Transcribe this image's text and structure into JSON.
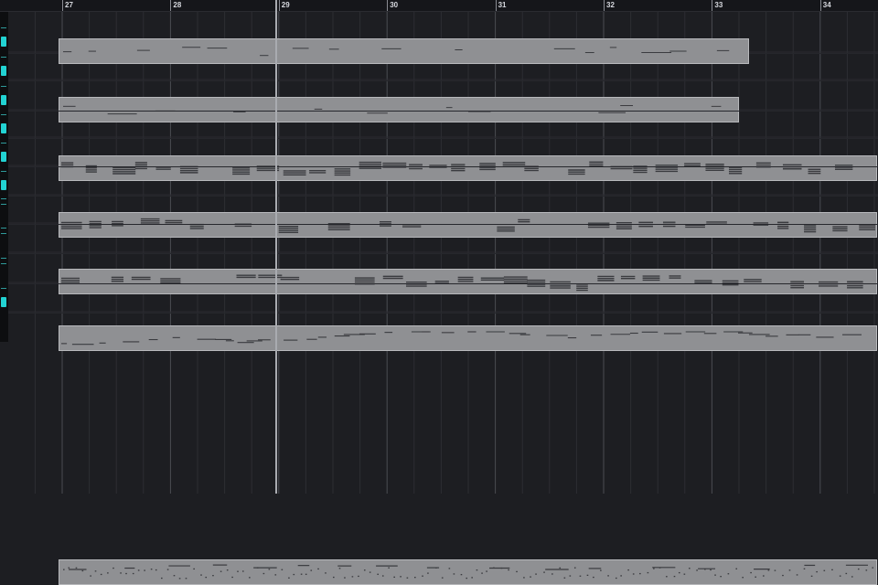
{
  "ruler": {
    "bars": [
      "27",
      "28",
      "29",
      "30",
      "31",
      "32",
      "33",
      "34"
    ]
  },
  "colors": {
    "background": "#1d1e22",
    "part_fill": "#8f9093",
    "part_border": "#b8b9bc",
    "note": "#3a3b3f",
    "marker": "#22d3d3",
    "playhead": "#a9abb0"
  },
  "tracks": [
    {
      "type": "sparse-melody",
      "parts": [
        {
          "from_bar": 26.97,
          "to_bar": 33.34
        }
      ]
    },
    {
      "type": "sparse-melody",
      "parts": [
        {
          "from_bar": 26.97,
          "to_bar": 33.25
        }
      ]
    },
    {
      "type": "chords",
      "parts": [
        {
          "from_bar": 26.97,
          "to_bar": 35.1
        }
      ]
    },
    {
      "type": "chords",
      "parts": [
        {
          "from_bar": 26.97,
          "to_bar": 35.1
        }
      ]
    },
    {
      "type": "chords",
      "parts": [
        {
          "from_bar": 26.97,
          "to_bar": 35.1
        }
      ]
    },
    {
      "type": "melody-dynamic",
      "parts": [
        {
          "from_bar": 26.97,
          "to_bar": 35.1
        }
      ]
    },
    {
      "type": "empty",
      "parts": []
    },
    {
      "type": "empty",
      "parts": []
    },
    {
      "type": "empty",
      "parts": []
    },
    {
      "type": "dotted",
      "parts": [
        {
          "from_bar": 26.97,
          "to_bar": 35.1
        }
      ]
    }
  ],
  "playhead_bar": 29.0
}
